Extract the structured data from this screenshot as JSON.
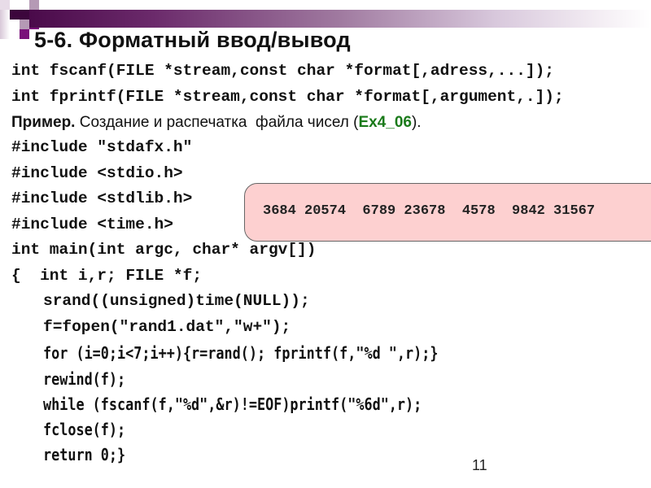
{
  "slide": {
    "title": "5-6. Форматный ввод/вывод",
    "prototypes": [
      "int fscanf(FILE *stream,const char *format[,adress,...]);",
      "int fprintf(FILE *stream,const char *format[,argument,.]);"
    ],
    "example": {
      "label": "Пример.",
      "text": " Создание и распечатка  файла чисел (",
      "link": "Ex4_06",
      "suffix": ")."
    },
    "code": [
      "#include \"stdafx.h\"",
      "#include <stdio.h>",
      "#include <stdlib.h>",
      "#include <time.h>",
      "int main(int argc, char* argv[])",
      "{  int i,r; FILE *f;",
      "srand((unsigned)time(NULL));",
      "f=fopen(\"rand1.dat\",\"w+\");",
      "for (i=0;i<7;i++){r=rand(); fprintf(f,\"%d \",r);}",
      "rewind(f);",
      "while (fscanf(f,\"%d\",&r)!=EOF)printf(\"%6d\",r);",
      "fclose(f);",
      "return 0;}"
    ],
    "output": "3684 20574  6789 23678  4578  9842 31567",
    "page_number": "11",
    "colors": {
      "accent_purple": "#6b2a6b",
      "link_green": "#1a7a1a",
      "output_bg": "#fdd0d0"
    }
  }
}
